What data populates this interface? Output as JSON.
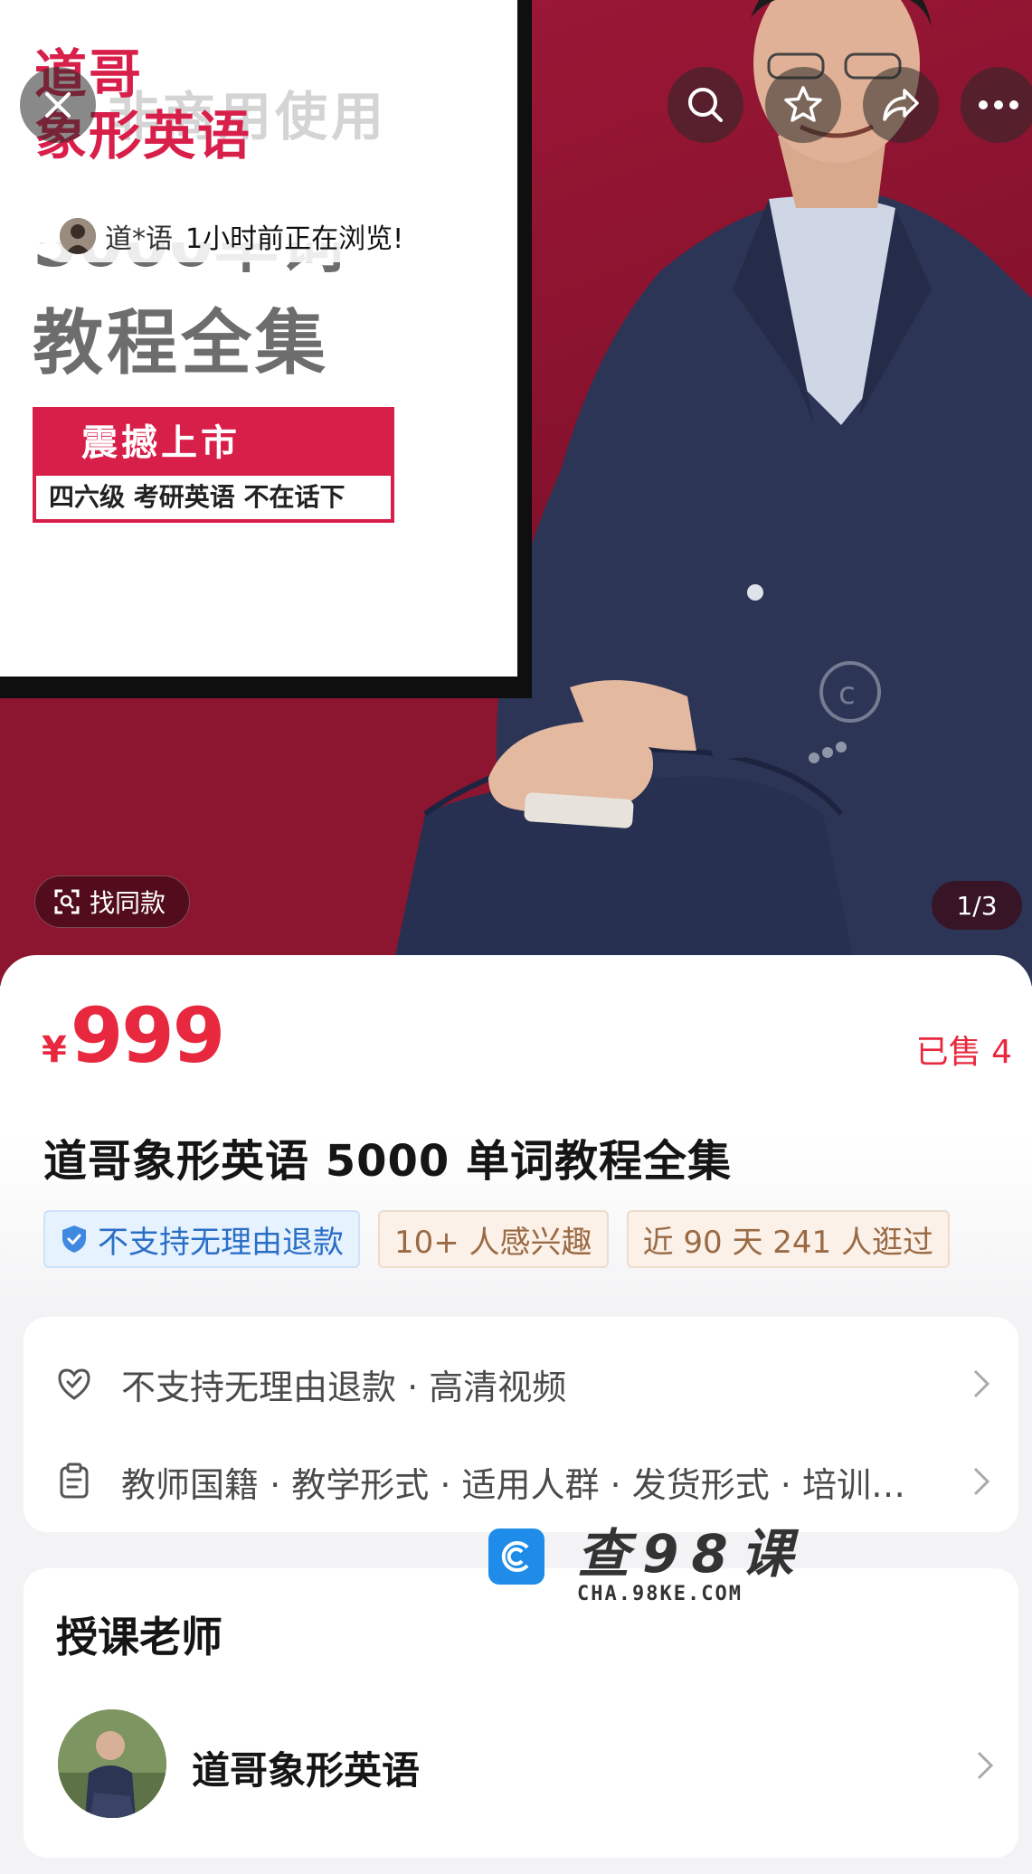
{
  "hero": {
    "poster": {
      "title_line1": "道哥",
      "title_line2": "象形英语",
      "watermark": "非商用使用",
      "subtitle_cut": "5000单词",
      "subtitle": "教程全集",
      "box_top": "震撼上市",
      "box_bottom": "四六级 考研英语 不在话下"
    },
    "browse_notice": {
      "user": "道*语",
      "text": "1小时前正在浏览!"
    },
    "find_same_label": "找同款",
    "page_indicator": "1/3",
    "icons": {
      "close": "close-icon",
      "search": "search-icon",
      "favorite": "star-icon",
      "share": "share-icon",
      "more": "more-icon"
    }
  },
  "product": {
    "currency": "¥",
    "price": "999",
    "sold": "已售 4",
    "title": "道哥象形英语 5000 单词教程全集",
    "tags": [
      {
        "label": "不支持无理由退款",
        "style": "blue"
      },
      {
        "label": "10+ 人感兴趣",
        "style": "tan"
      },
      {
        "label": "近 90 天 241 人逛过",
        "style": "tan"
      }
    ],
    "info_rows": [
      {
        "icon": "heart-shield-icon",
        "text": "不支持无理由退款 · 高清视频"
      },
      {
        "icon": "clipboard-icon",
        "text": "教师国籍 · 教学形式 · 适用人群 · 发货形式 · 培训…"
      }
    ]
  },
  "teacher": {
    "heading": "授课老师",
    "name": "道哥象形英语"
  },
  "site_watermark": {
    "name": "查98课",
    "url": "CHA.98KE.COM"
  },
  "colors": {
    "accent": "#e8283e",
    "hero_bg": "#8c1530",
    "poster_red": "#d81f4a",
    "tag_blue": "#2a6fc6",
    "tag_tan": "#9a6a44"
  }
}
